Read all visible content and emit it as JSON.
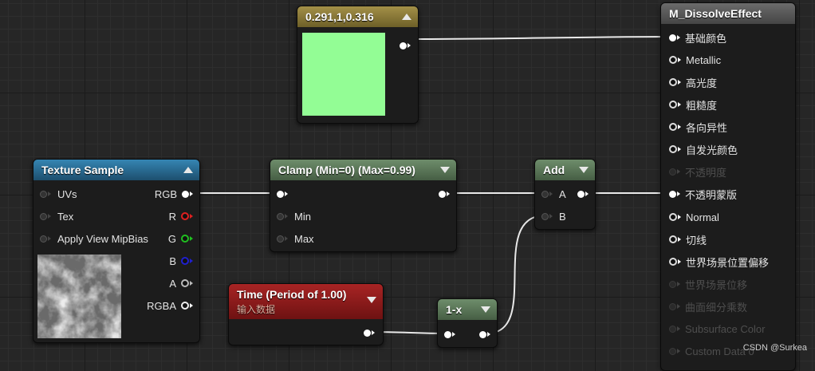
{
  "colors": {
    "swatch": "#93fd95",
    "texture_header": "#2b6b90",
    "clamp_header": "#5c7a5a",
    "time_header": "#8e1b1b",
    "const_header": "#8b7a3a",
    "result_header": "#5a5a5a",
    "pin_red": "#e02020",
    "pin_green": "#20c020",
    "pin_blue": "#2020d0"
  },
  "constant_node": {
    "title": "0.291,1,0.316"
  },
  "texture_node": {
    "title": "Texture Sample",
    "inputs": [
      "UVs",
      "Tex",
      "Apply View MipBias"
    ],
    "outputs": [
      "RGB",
      "R",
      "G",
      "B",
      "A",
      "RGBA"
    ]
  },
  "clamp_node": {
    "title": "Clamp (Min=0) (Max=0.99)",
    "inputs": [
      "Min",
      "Max"
    ]
  },
  "add_node": {
    "title": "Add",
    "inputs": [
      "A",
      "B"
    ]
  },
  "time_node": {
    "title": "Time (Period of 1.00)",
    "subtitle": "输入数据"
  },
  "oneminus_node": {
    "title": "1-x"
  },
  "material_node": {
    "title": "M_DissolveEffect",
    "inputs": [
      "基础颜色",
      "Metallic",
      "高光度",
      "粗糙度",
      "各向异性",
      "自发光颜色",
      "不透明度",
      "不透明蒙版",
      "Normal",
      "切线",
      "世界场景位置偏移",
      "世界场景位移",
      "曲面细分乘数",
      "Subsurface Color",
      "Custom Data 0"
    ]
  },
  "watermark": "CSDN @Surkea"
}
